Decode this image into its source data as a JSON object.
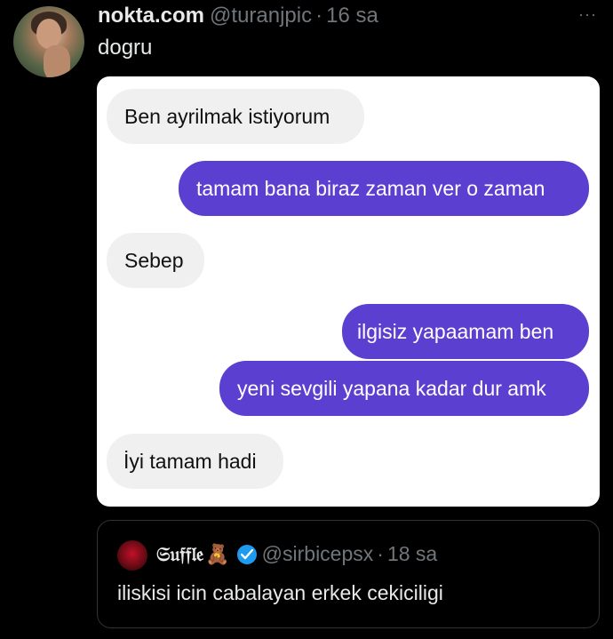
{
  "tweet": {
    "display_name": "nokta.com",
    "handle": "@turanjpic",
    "separator": "·",
    "time": "16 sa",
    "more_icon": "···",
    "text": "dogru"
  },
  "chat": {
    "messages": [
      {
        "side": "in",
        "text": "Ben ayrilmak istiyorum"
      },
      {
        "side": "out",
        "text": "tamam bana biraz zaman ver o zaman"
      },
      {
        "side": "in",
        "text": "Sebep"
      },
      {
        "side": "out",
        "text": "ilgisiz yapaamam ben"
      },
      {
        "side": "out",
        "text": "yeni sevgili yapana kadar dur amk"
      },
      {
        "side": "in",
        "text": "İyi tamam hadi"
      }
    ],
    "colors": {
      "incoming": "#f0f0f0",
      "outgoing": "#5a3fd1"
    }
  },
  "quote": {
    "display_name": "𝔖𝔲𝔣𝔣𝔩𝔢",
    "bear_emoji": "🧸",
    "verified_icon": "verified-badge-icon",
    "handle": "@sirbicepsx",
    "separator": "·",
    "time": "18 sa",
    "text": "iliskisi icin cabalayan erkek cekiciligi"
  }
}
